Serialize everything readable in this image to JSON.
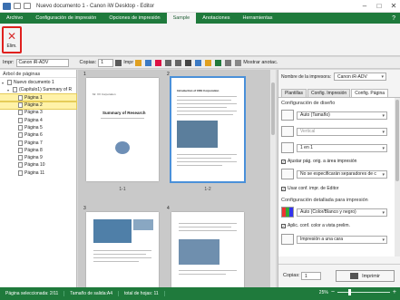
{
  "window": {
    "title": "Nuevo documento 1 - Canon iW Desktop - Editor"
  },
  "ribbon_tabs": [
    {
      "label": "Archivo"
    },
    {
      "label": "Configuración de impresión"
    },
    {
      "label": "Opciones de impresión"
    },
    {
      "label": "Sample"
    },
    {
      "label": "Anotaciones"
    },
    {
      "label": "Herramientas"
    }
  ],
  "ribbon": {
    "close_label": "Elim."
  },
  "toolbar": {
    "printer_label": "Impr:",
    "printer_value": "Canon iR-ADV",
    "copies_label": "Copias:",
    "copies_value": "1",
    "impr_label": "Impr",
    "show_annot_label": "Mostrar anotac."
  },
  "left_pane": {
    "header": "Árbol de páginas",
    "tree": [
      {
        "label": "Nuevo documento 1"
      },
      {
        "label": "(Capítulo1) Summary of R"
      },
      {
        "label": "Página 1"
      },
      {
        "label": "Página 2"
      },
      {
        "label": "Página 3"
      },
      {
        "label": "Página 4"
      },
      {
        "label": "Página 5"
      },
      {
        "label": "Página 6"
      },
      {
        "label": "Página 7"
      },
      {
        "label": "Página 8"
      },
      {
        "label": "Página 9"
      },
      {
        "label": "Página 10"
      },
      {
        "label": "Página 11"
      }
    ]
  },
  "preview": {
    "pages": [
      {
        "num": "1",
        "caption": "1-1",
        "heading": "Summary of Research",
        "subheading": "Mr. XX Corporation"
      },
      {
        "num": "2",
        "caption": "1-2",
        "heading": "Introduction of CDE Corporation"
      },
      {
        "num": "3"
      },
      {
        "num": "4"
      }
    ]
  },
  "right_pane": {
    "printer_name_label": "Nombre de la impresora:",
    "printer_name_value": "Canon iR-ADV",
    "tabs": [
      "Plantillas",
      "Config. Impresión",
      "Config. Página"
    ],
    "layout_title": "Configuración de diseño",
    "page_size_value": "Auto (Tamaño)",
    "orientation_value": "Vertical",
    "pages_per_sheet_value": "1 en 1",
    "fit_checkbox_label": "Ajustar pág. orig. a área impresión",
    "separator_value": "No se especificarán separadores de c",
    "use_config_label": "Usar conf. impr. de Editor",
    "detailed_title": "Configuración detallada para impresión",
    "color_value": "Auto (Color/Blanco y negro)",
    "apply_label": "Aplic. conf. color a vista prelim.",
    "print_mode_value": "Impresión a una cara",
    "copies_label": "Copias:",
    "copies_value": "1",
    "print_button": "Imprimir"
  },
  "status": {
    "selected": "Página seleccionada: 2/11",
    "size": "Tamaño de salida:A4",
    "total": "total de hojas: 11",
    "zoom": "25%"
  }
}
